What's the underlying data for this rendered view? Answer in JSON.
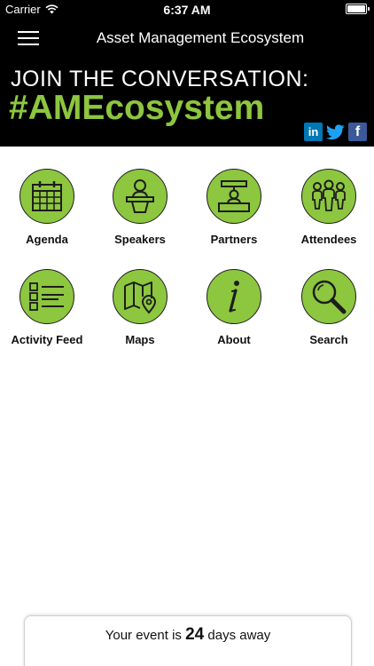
{
  "status_bar": {
    "carrier": "Carrier",
    "time": "6:37 AM",
    "wifi_icon": "wifi-icon",
    "battery_icon": "battery-icon"
  },
  "nav": {
    "title": "Asset Management Ecosystem",
    "menu_icon": "hamburger-menu-icon"
  },
  "banner": {
    "line1": "JOIN THE CONVERSATION:",
    "hashtag": "#AMEcosystem",
    "social": [
      {
        "name": "linkedin-icon",
        "label": "in"
      },
      {
        "name": "twitter-icon",
        "label": ""
      },
      {
        "name": "facebook-icon",
        "label": "f"
      }
    ]
  },
  "menu": {
    "items": [
      {
        "label": "Agenda",
        "icon": "calendar-icon"
      },
      {
        "label": "Speakers",
        "icon": "speaker-podium-icon"
      },
      {
        "label": "Partners",
        "icon": "partner-booth-icon"
      },
      {
        "label": "Attendees",
        "icon": "people-group-icon"
      },
      {
        "label": "Activity Feed",
        "icon": "list-icon"
      },
      {
        "label": "Maps",
        "icon": "map-pin-icon"
      },
      {
        "label": "About",
        "icon": "info-icon"
      },
      {
        "label": "Search",
        "icon": "magnifier-icon"
      }
    ]
  },
  "countdown": {
    "prefix": "Your event is",
    "days": "24",
    "suffix": "days away"
  },
  "colors": {
    "accent_green": "#8dc63f",
    "bar_black": "#000000",
    "linkedin": "#0077b5",
    "twitter": "#1da1f2",
    "facebook": "#3b5998"
  }
}
